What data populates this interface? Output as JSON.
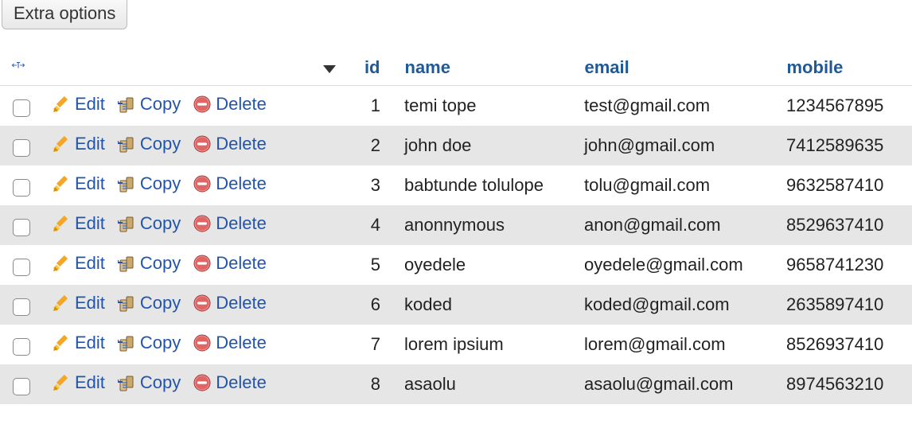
{
  "buttons": {
    "extra_options": "Extra options"
  },
  "columns": {
    "id": "id",
    "name": "name",
    "email": "email",
    "mobile": "mobile"
  },
  "actions": {
    "edit": "Edit",
    "copy": "Copy",
    "delete": "Delete"
  },
  "rows": [
    {
      "id": "1",
      "name": "temi tope",
      "email": "test@gmail.com",
      "mobile": "1234567895"
    },
    {
      "id": "2",
      "name": "john doe",
      "email": "john@gmail.com",
      "mobile": "7412589635"
    },
    {
      "id": "3",
      "name": "babtunde tolulope",
      "email": "tolu@gmail.com",
      "mobile": "9632587410"
    },
    {
      "id": "4",
      "name": "anonnymous",
      "email": "anon@gmail.com",
      "mobile": "8529637410"
    },
    {
      "id": "5",
      "name": "oyedele",
      "email": "oyedele@gmail.com",
      "mobile": "9658741230"
    },
    {
      "id": "6",
      "name": "koded",
      "email": "koded@gmail.com",
      "mobile": "2635897410"
    },
    {
      "id": "7",
      "name": "lorem ipsium",
      "email": "lorem@gmail.com",
      "mobile": "8526937410"
    },
    {
      "id": "8",
      "name": "asaolu",
      "email": "asaolu@gmail.com",
      "mobile": "8974563210"
    }
  ]
}
